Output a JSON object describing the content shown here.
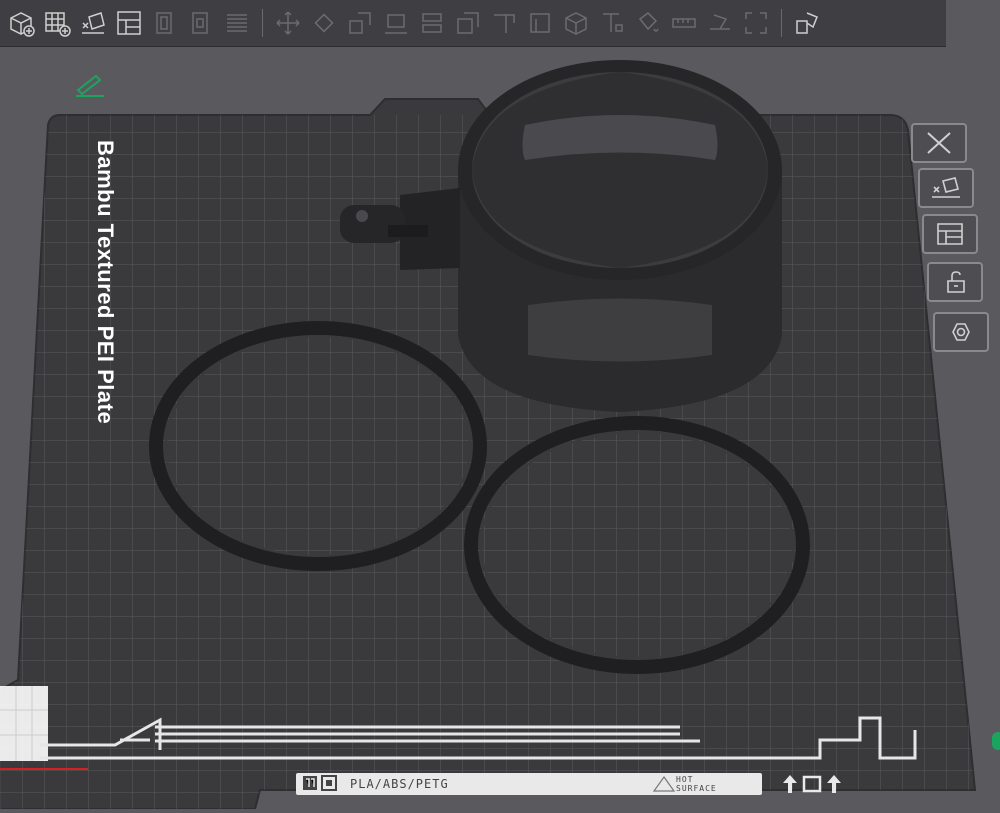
{
  "plate": {
    "title": "Bambu Textured PEI Plate",
    "material": "PLA/ABS/PETG",
    "hot_line1": "HOT",
    "hot_line2": "SURFACE"
  },
  "toolbar": {
    "icons": [
      "add-object-icon",
      "add-plate-icon",
      "auto-orient-icon",
      "arrange-icon",
      "split-objects-icon",
      "split-parts-icon",
      "layers-icon",
      "move-icon",
      "rotate-icon",
      "scale-icon",
      "lay-on-face-icon",
      "cut-icon",
      "boolean-icon",
      "support-paint-icon",
      "seam-paint-icon",
      "cube-icon",
      "text-icon",
      "color-paint-icon",
      "measure-icon",
      "assembly-icon",
      "fullscreen-icon",
      "variable-layer-icon"
    ]
  },
  "colors": {
    "toolbar_bg": "#3f3f43",
    "plate_bg": "#3b3b3e",
    "grid": "#5a5a5e",
    "object": "#2a2a2c",
    "accent_green": "#19a55e"
  }
}
